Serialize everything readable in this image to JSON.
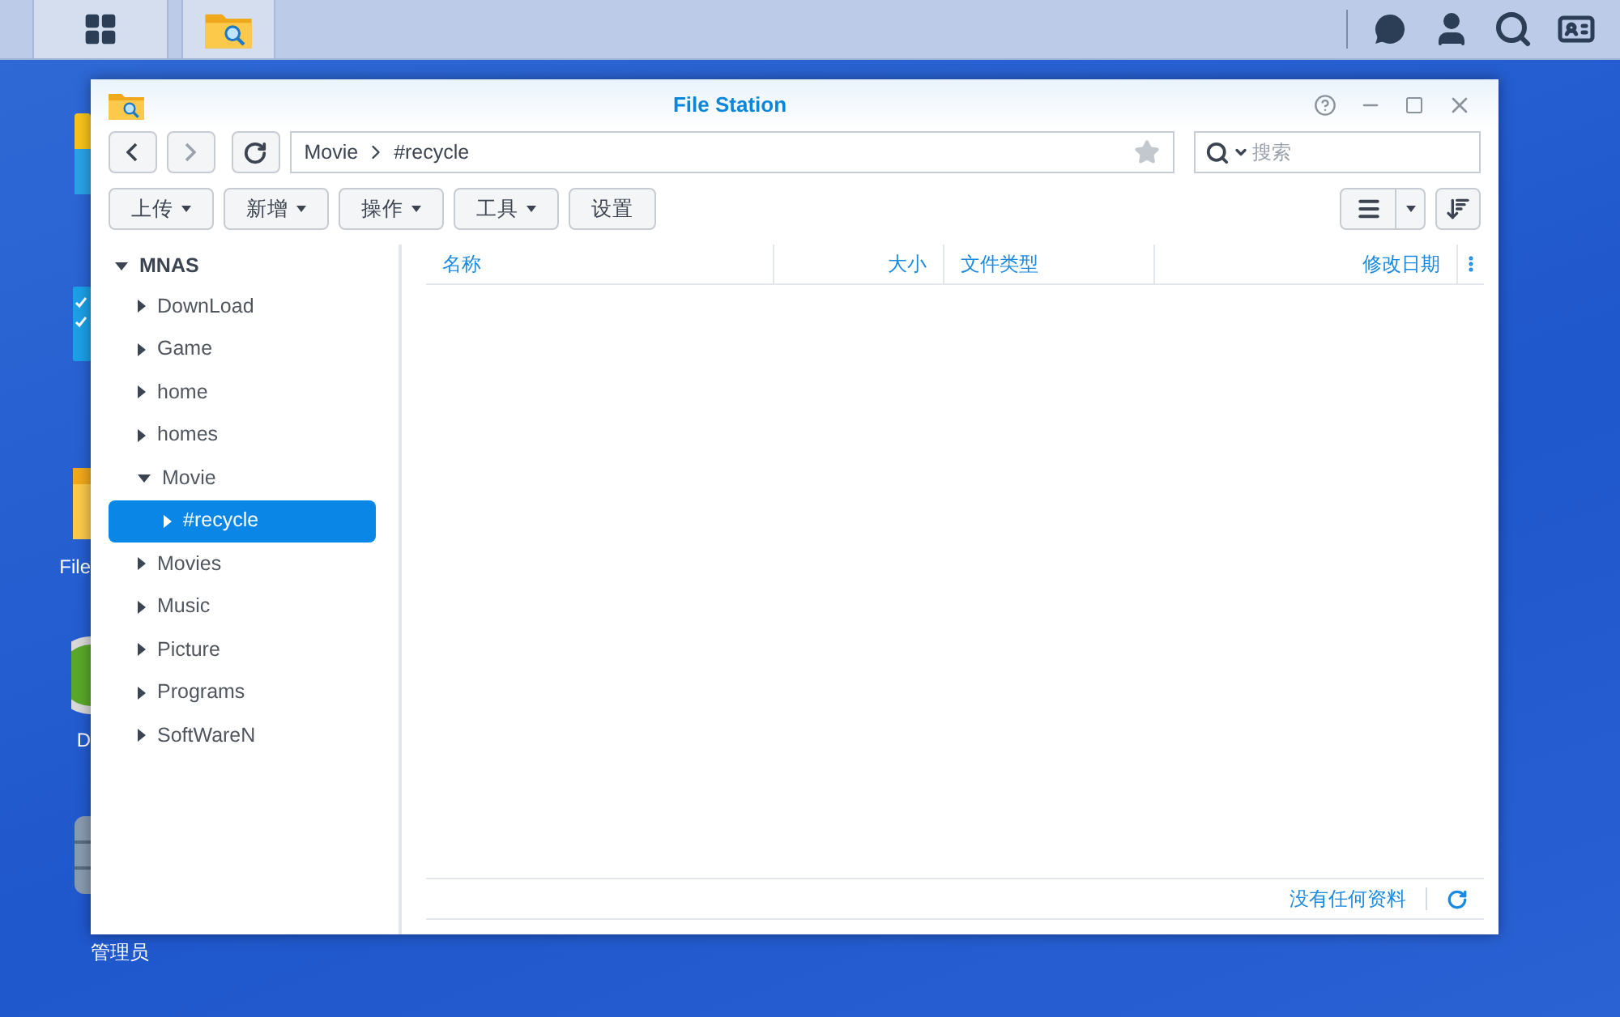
{
  "desktop_icons": [
    {
      "kind": "store"
    },
    {
      "kind": "checklist"
    },
    {
      "kind": "folder",
      "label": "File"
    },
    {
      "kind": "disc",
      "label": "D"
    },
    {
      "kind": "storage",
      "label": "管理员"
    }
  ],
  "window": {
    "title": "File Station"
  },
  "path": [
    "Movie",
    "#recycle"
  ],
  "search": {
    "placeholder": "搜索"
  },
  "toolbar": [
    {
      "label": "上传",
      "dropdown": true
    },
    {
      "label": "新增",
      "dropdown": true
    },
    {
      "label": "操作",
      "dropdown": true
    },
    {
      "label": "工具",
      "dropdown": true
    },
    {
      "label": "设置",
      "dropdown": false
    }
  ],
  "tree": {
    "label": "MNAS",
    "expanded": true,
    "children": [
      {
        "label": "DownLoad",
        "expanded": false,
        "selected": false
      },
      {
        "label": "Game",
        "expanded": false,
        "selected": false
      },
      {
        "label": "home",
        "expanded": false,
        "selected": false
      },
      {
        "label": "homes",
        "expanded": false,
        "selected": false
      },
      {
        "label": "Movie",
        "expanded": true,
        "selected": false,
        "children": [
          {
            "label": "#recycle",
            "expanded": false,
            "selected": true
          }
        ]
      },
      {
        "label": "Movies",
        "expanded": false,
        "selected": false
      },
      {
        "label": "Music",
        "expanded": false,
        "selected": false
      },
      {
        "label": "Picture",
        "expanded": false,
        "selected": false
      },
      {
        "label": "Programs",
        "expanded": false,
        "selected": false
      },
      {
        "label": "SoftWareN",
        "expanded": false,
        "selected": false
      }
    ]
  },
  "table": {
    "columns": [
      {
        "label": "名称"
      },
      {
        "label": "大小"
      },
      {
        "label": "文件类型"
      },
      {
        "label": "修改日期"
      }
    ]
  },
  "status_bar": {
    "text": "没有任何资料"
  }
}
